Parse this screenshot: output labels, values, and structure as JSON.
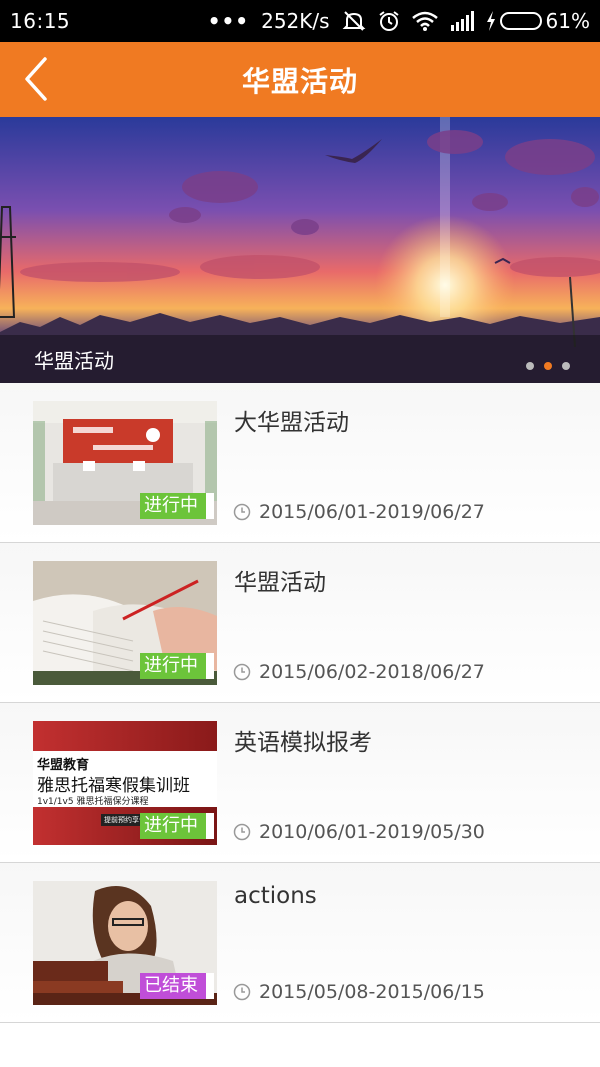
{
  "status_bar": {
    "time": "16:15",
    "net_speed": "252K/s",
    "battery_text": "61%",
    "battery_level": 0.61,
    "icons": [
      "dots-icon",
      "mute-icon",
      "alarm-icon",
      "wifi-icon",
      "signal-icon",
      "charging-icon",
      "battery-icon"
    ]
  },
  "header": {
    "title": "华盟活动",
    "back_icon": "chevron-left-icon",
    "color": "#f07a22"
  },
  "banner": {
    "caption": "华盟活动",
    "dots_count": 3,
    "active_dot": 1
  },
  "activities": [
    {
      "title": "大华盟活动",
      "date_range": "2015/06/01-2019/06/27",
      "status": "进行中",
      "status_type": "ongoing"
    },
    {
      "title": "华盟活动",
      "date_range": "2015/06/02-2018/06/27",
      "status": "进行中",
      "status_type": "ongoing"
    },
    {
      "title": "英语模拟报考",
      "date_range": "2010/06/01-2019/05/30",
      "status": "进行中",
      "status_type": "ongoing",
      "thumb_text": {
        "line1": "华盟教育",
        "line2": "雅思托福寒假集训班",
        "line3": "1v1/1v5 雅思托福保分课程",
        "line4": "提前预约享优惠"
      }
    },
    {
      "title": "actions",
      "date_range": "2015/05/08-2015/06/15",
      "status": "已结束",
      "status_type": "ended"
    }
  ],
  "colors": {
    "ongoing": "#6cc43a",
    "ended": "#c04ed8",
    "accent": "#f07a22"
  }
}
